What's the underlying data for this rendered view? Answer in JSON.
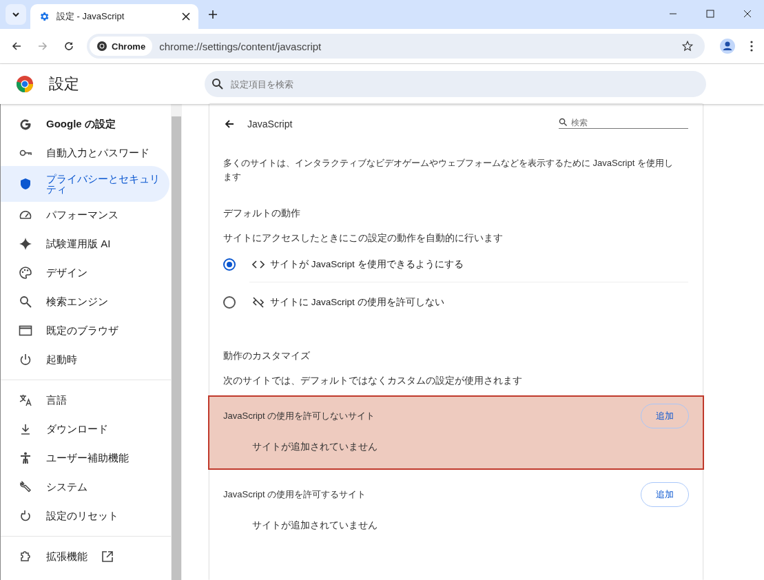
{
  "tabs": [
    {
      "title": "設定 - JavaScript",
      "selected": true
    }
  ],
  "toolbar": {
    "site_chip": "Chrome",
    "url": "chrome://settings/content/javascript"
  },
  "header": {
    "title": "設定",
    "search": {
      "placeholder": "設定項目を検索"
    }
  },
  "sidebar": {
    "groups": [
      [
        {
          "label": "Google の設定",
          "selected": false
        },
        {
          "label": "自動入力とパスワード",
          "selected": false
        },
        {
          "label": "プライバシーとセキュリティ",
          "selected": true
        },
        {
          "label": "パフォーマンス",
          "selected": false
        },
        {
          "label": "試験運用版 AI",
          "selected": false
        },
        {
          "label": "デザイン",
          "selected": false
        },
        {
          "label": "検索エンジン",
          "selected": false
        },
        {
          "label": "既定のブラウザ",
          "selected": false
        },
        {
          "label": "起動時",
          "selected": false
        }
      ],
      [
        {
          "label": "言語",
          "selected": false
        },
        {
          "label": "ダウンロード",
          "selected": false
        },
        {
          "label": "ユーザー補助機能",
          "selected": false
        },
        {
          "label": "システム",
          "selected": false
        },
        {
          "label": "設定のリセット",
          "selected": false
        }
      ],
      [
        {
          "label": "拡張機能",
          "selected": false,
          "external": true
        }
      ]
    ]
  },
  "page": {
    "title": "JavaScript",
    "search": {
      "placeholder": "検索"
    },
    "description": "多くのサイトは、インタラクティブなビデオゲームやウェブフォームなどを表示するために JavaScript を使用します",
    "default_heading": "デフォルトの動作",
    "default_note": "サイトにアクセスしたときにこの設定の動作を自動的に行います",
    "options": [
      {
        "label": "サイトが JavaScript を使用できるようにする",
        "selected": true
      },
      {
        "label": "サイトに JavaScript の使用を許可しない",
        "selected": false
      }
    ],
    "custom_heading": "動作のカスタマイズ",
    "custom_note": "次のサイトでは、デフォルトではなくカスタムの設定が使用されます",
    "site_lists": [
      {
        "title": "JavaScript の使用を許可しないサイト",
        "button": "追加",
        "empty": "サイトが追加されていません",
        "highlighted": true
      },
      {
        "title": "JavaScript の使用を許可するサイト",
        "button": "追加",
        "empty": "サイトが追加されていません",
        "highlighted": false
      }
    ]
  }
}
